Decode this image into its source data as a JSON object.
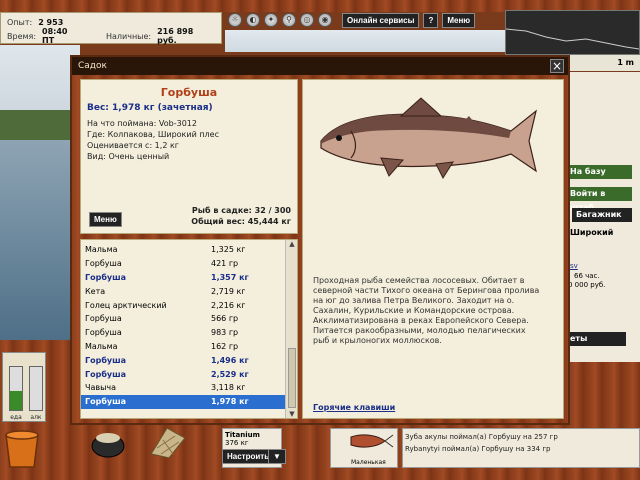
{
  "stats": {
    "experience_label": "Опыт:",
    "experience_value": "2 953",
    "time_label": "Время:",
    "time_value": "08:40 ПТ",
    "money_label": "Наличные:",
    "money_value": "216 898 руб."
  },
  "toolbar": {
    "online_services": "Онлайн сервисы",
    "help": "?",
    "menu": "Меню"
  },
  "depth_box": "1 m",
  "right_side": {
    "to_base": "На базу",
    "to_hq": "Войти в штаб",
    "trunk": "Багажник",
    "location_name": "Широкий",
    "hours_text": "66 час.",
    "price_text": "0 000 руб.",
    "link_text": "sv",
    "cut_text": "еты"
  },
  "dialog": {
    "title": "Садок",
    "fish_name": "Горбуша",
    "weight_line": "Вес: 1,978 кг (зачетная)",
    "caught_with": "На что поймана: Vob-3012",
    "where": "Где: Колпакова, Широкий плес",
    "valued_from": "Оценивается с: 1,2 кг",
    "kind": "Вид: Очень ценный",
    "menu_button": "Меню",
    "keep_count": "Рыб в садке: 32 / 300",
    "total_weight": "Общий вес: 45,444 кг",
    "description": "Проходная рыба семейства лососевых. Обитает в северной части Тихого океана от Берингова пролива на юг до залива Петра Великого. Заходит на о. Сахалин, Курильские и Командорские острова. Акклиматизирована в реках Европейского Севера. Питается ракообразными, молодью пелагических рыб и крылоногих моллюсков.",
    "hotkeys": "Горячие клавиши",
    "fish_list": [
      {
        "name": "Мальма",
        "weight": "1,325 кг",
        "style": "normal"
      },
      {
        "name": "Горбуша",
        "weight": "421 гр",
        "style": "normal"
      },
      {
        "name": "Горбуша",
        "weight": "1,357 кг",
        "style": "bold"
      },
      {
        "name": "Кета",
        "weight": "2,719 кг",
        "style": "normal"
      },
      {
        "name": "Голец арктический",
        "weight": "2,216 кг",
        "style": "normal"
      },
      {
        "name": "Горбуша",
        "weight": "566 гр",
        "style": "normal"
      },
      {
        "name": "Горбуша",
        "weight": "983 гр",
        "style": "normal"
      },
      {
        "name": "Мальма",
        "weight": "162 гр",
        "style": "normal"
      },
      {
        "name": "Горбуша",
        "weight": "1,496 кг",
        "style": "bold"
      },
      {
        "name": "Горбуша",
        "weight": "2,529 кг",
        "style": "bold"
      },
      {
        "name": "Чавыча",
        "weight": "3,118 кг",
        "style": "normal"
      },
      {
        "name": "Горбуша",
        "weight": "1,978 кг",
        "style": "selected"
      }
    ]
  },
  "gauges": {
    "left_label": "еда",
    "right_label": "алк",
    "left_fill": 0.45,
    "right_fill": 0.0
  },
  "rod": {
    "name": "Titanium",
    "weight": "376 кг",
    "setup_button": "Настроить"
  },
  "lure": {
    "label": "Маленькая"
  },
  "log": [
    "Зуба акулы поймал(а) Горбушу на 257 гр",
    "Rybanytyi поймал(а) Горбушу на 334 гр"
  ],
  "colors": {
    "accent_blue": "#1a2e8a",
    "title_red": "#b0401a",
    "selection": "#2a6fd0"
  }
}
